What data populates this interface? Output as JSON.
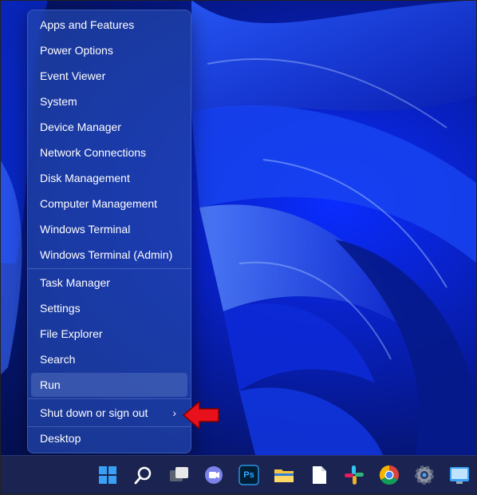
{
  "menu": {
    "items": [
      {
        "label": "Apps and Features"
      },
      {
        "label": "Power Options"
      },
      {
        "label": "Event Viewer"
      },
      {
        "label": "System"
      },
      {
        "label": "Device Manager"
      },
      {
        "label": "Network Connections"
      },
      {
        "label": "Disk Management"
      },
      {
        "label": "Computer Management"
      },
      {
        "label": "Windows Terminal"
      },
      {
        "label": "Windows Terminal (Admin)"
      },
      {
        "label": "Task Manager"
      },
      {
        "label": "Settings"
      },
      {
        "label": "File Explorer"
      },
      {
        "label": "Search"
      },
      {
        "label": "Run"
      },
      {
        "label": "Shut down or sign out"
      },
      {
        "label": "Desktop"
      }
    ],
    "highlighted_item": "Run",
    "submenu_chevron": "›"
  },
  "annotation": {
    "icon": "red-arrow-icon",
    "color": "#e8101a"
  },
  "taskbar": {
    "icons": [
      "windows-start-icon",
      "search-icon",
      "task-view-icon",
      "teams-chat-icon",
      "photoshop-icon",
      "file-explorer-icon",
      "document-icon",
      "slack-icon",
      "chrome-icon",
      "settings-icon",
      "screen-app-icon"
    ],
    "photoshop_label": "Ps"
  },
  "colors": {
    "accent": "#0078d4",
    "taskbar": "#1b2450",
    "menu_text": "#ffffff"
  }
}
